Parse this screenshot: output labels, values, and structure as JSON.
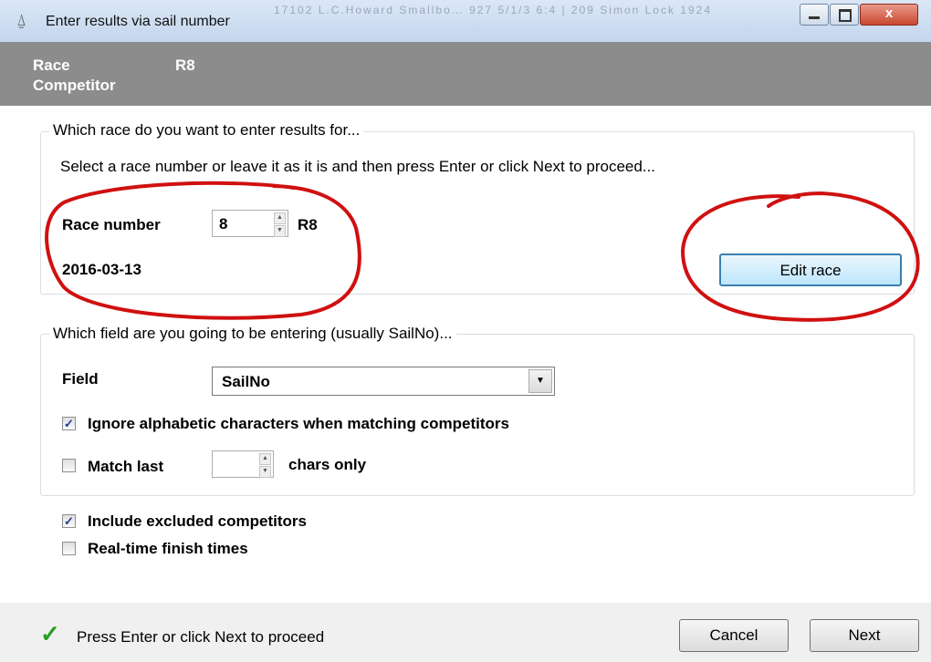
{
  "window": {
    "title": "Enter results via sail number",
    "background_text": "17102   L.C.Howard Smallbo…   927   5/1/3  6:4  |  209   Simon Lock   1924"
  },
  "header": {
    "race_label": "Race",
    "race_value": "R8",
    "competitor_label": "Competitor"
  },
  "race_group": {
    "legend": "Which race do you want to enter results for...",
    "instruction": "Select a race number or leave it as it is and then press Enter or click Next to proceed...",
    "race_number_label": "Race number",
    "race_number_value": "8",
    "race_code": "R8",
    "race_date": "2016-03-13",
    "edit_button": "Edit race"
  },
  "field_group": {
    "legend": "Which field are you going to be entering (usually SailNo)...",
    "field_label": "Field",
    "field_value": "SailNo",
    "ignore_alpha_label": "Ignore alphabetic characters when matching competitors",
    "ignore_alpha_checked": true,
    "match_last_label": "Match last",
    "match_last_checked": false,
    "match_last_value": "",
    "chars_only_label": "chars only"
  },
  "options": {
    "include_excluded_label": "Include excluded competitors",
    "include_excluded_checked": true,
    "realtime_label": "Real-time finish times",
    "realtime_checked": false
  },
  "footer": {
    "status_text": "Press Enter or click Next to proceed",
    "cancel_button": "Cancel",
    "next_button": "Next"
  },
  "colors": {
    "header_bg": "#8c8c8c",
    "annotation": "#d01010",
    "status_check": "#22a022"
  }
}
